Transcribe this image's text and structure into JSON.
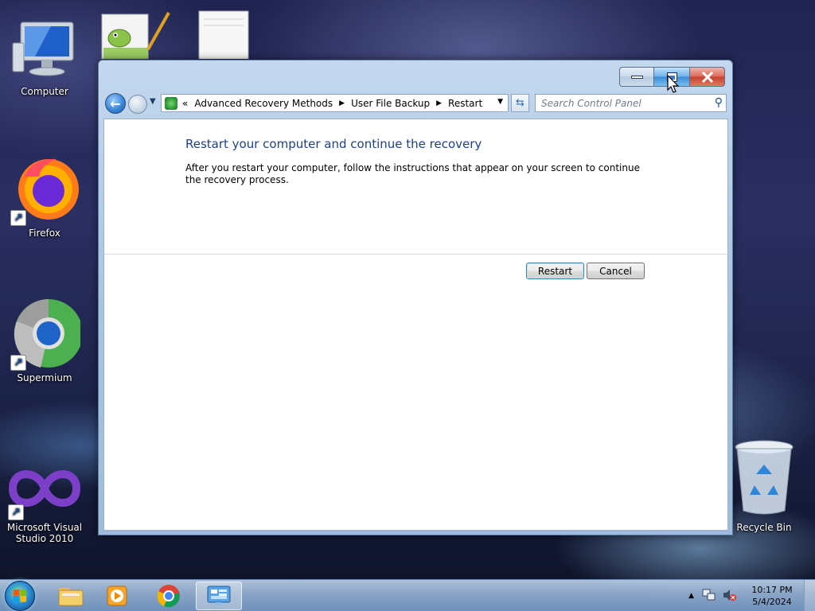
{
  "desktop": {
    "icons": [
      {
        "label": "Computer"
      },
      {
        "label": "Firefox"
      },
      {
        "label": "Supermium"
      },
      {
        "label": "Microsoft Visual Studio 2010"
      },
      {
        "label": "Recycle Bin"
      }
    ]
  },
  "window": {
    "address": {
      "prefix": "«",
      "crumbs": [
        "Advanced Recovery Methods",
        "User File Backup",
        "Restart"
      ]
    },
    "search": {
      "placeholder": "Search Control Panel"
    },
    "heading": "Restart your computer and continue the recovery",
    "description": "After you restart your computer, follow the instructions that appear on your screen to continue the recovery process.",
    "buttons": {
      "restart": "Restart",
      "cancel": "Cancel"
    }
  },
  "taskbar": {
    "apps": [
      "Windows Explorer",
      "Windows Media Player",
      "Google Chrome",
      "Control Panel"
    ],
    "active_app": "Control Panel",
    "clock": {
      "time": "10:17 PM",
      "date": "5/4/2024"
    }
  },
  "colors": {
    "heading": "#1e3f8a",
    "close_button": "#c5402f",
    "maximize_hover": "#3b8ad6"
  }
}
